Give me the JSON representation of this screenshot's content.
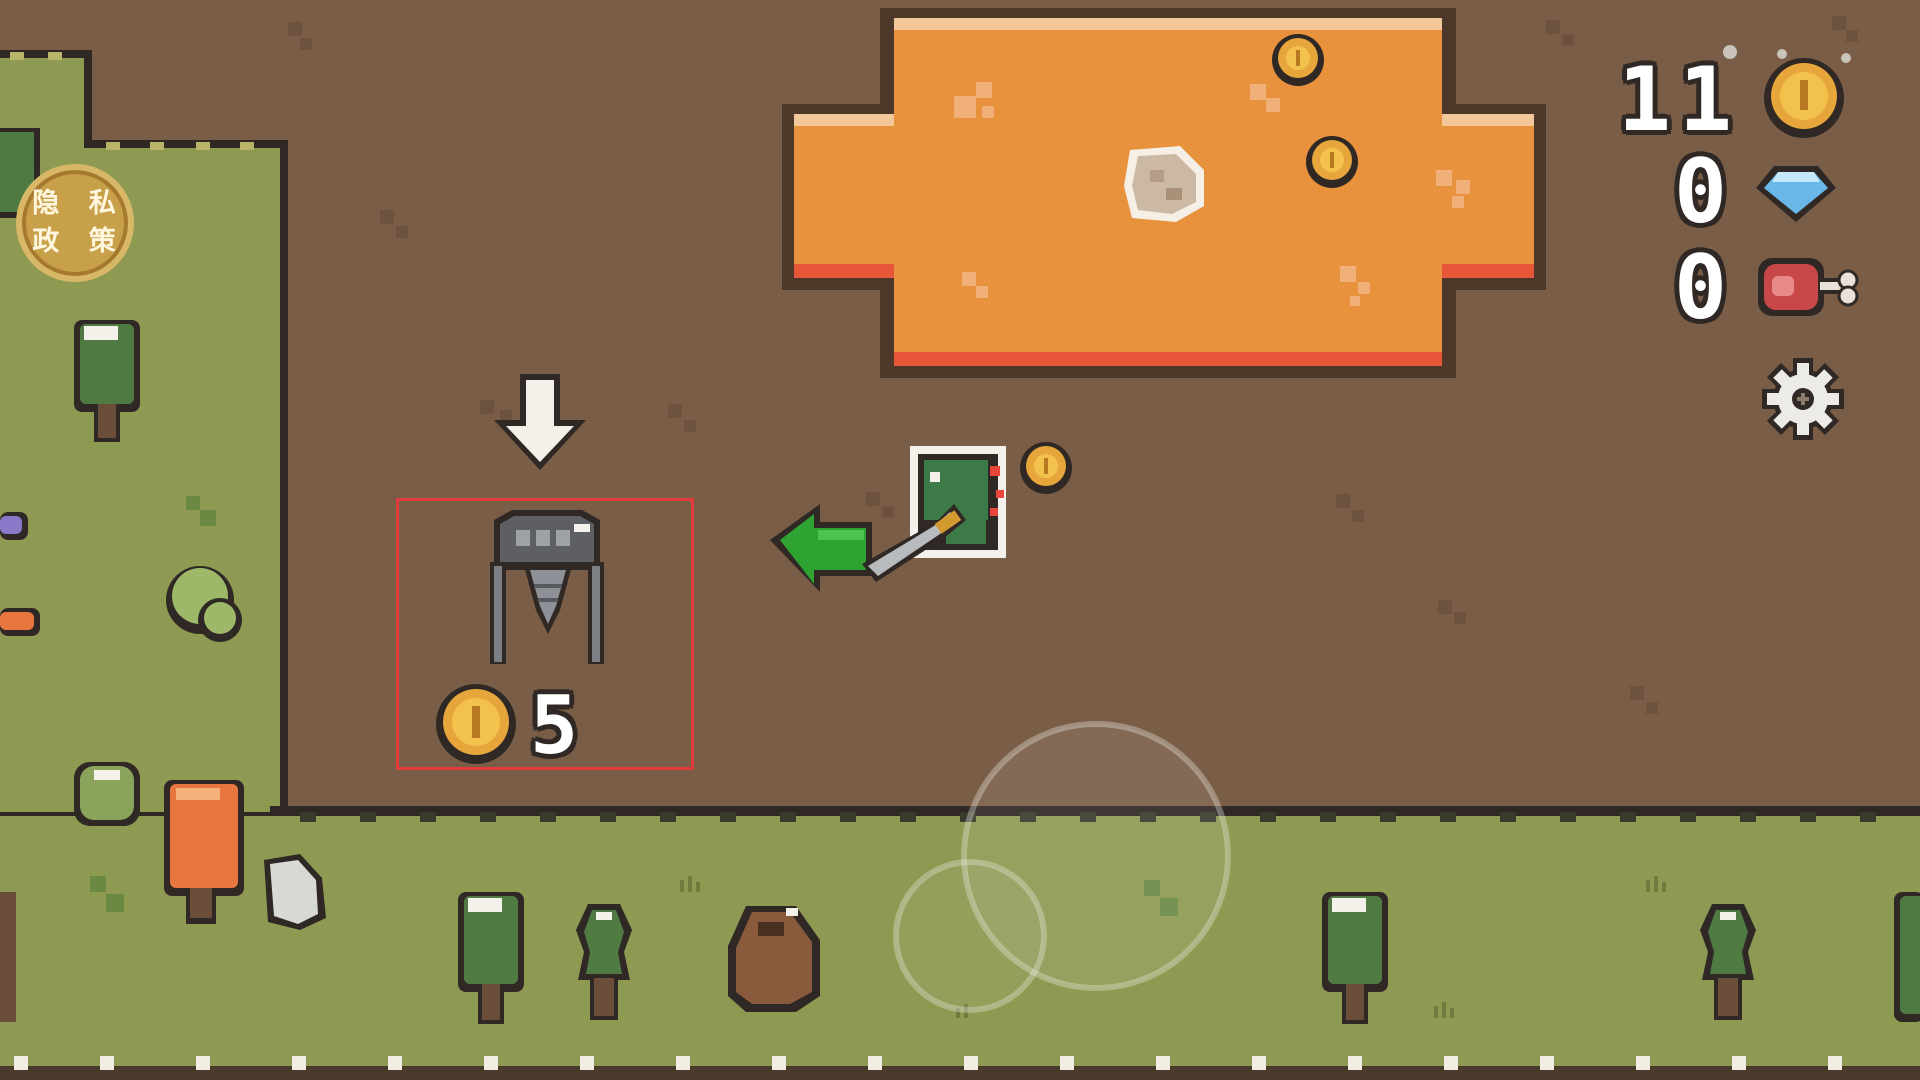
{
  "hud": {
    "coins_count": "11",
    "gems_count": "0",
    "meat_count": "0",
    "coin_icon": "coin-icon",
    "gem_icon": "diamond-icon",
    "meat_icon": "meat-icon",
    "settings_icon": "gear-icon"
  },
  "privacy_button": {
    "label": "隐 私\n政 策"
  },
  "shop": {
    "item": "drill-machine",
    "price": "5",
    "currency_icon": "coin-icon"
  },
  "colors": {
    "dirt": "#7a5d46",
    "grass": "#8e9a52",
    "lava": "#e8923e",
    "highlight_box": "#e03a3a",
    "arrow_green": "#2fa332"
  }
}
